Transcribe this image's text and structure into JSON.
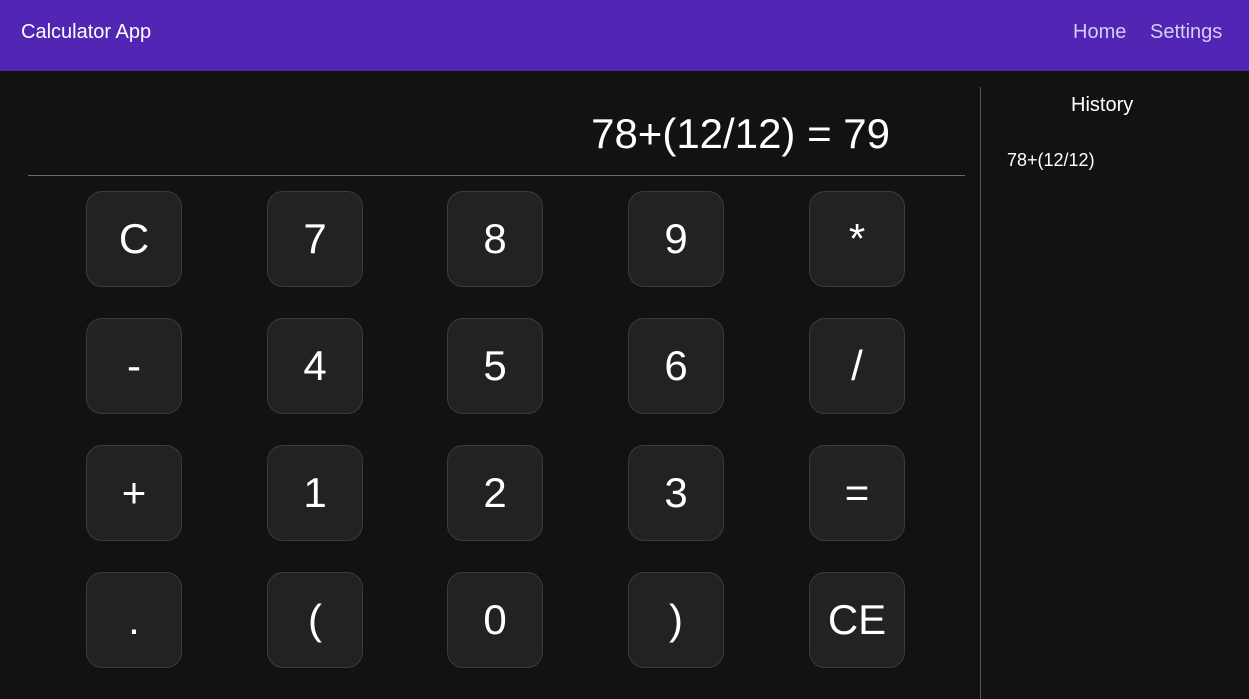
{
  "header": {
    "title": "Calculator App",
    "nav": [
      "Home",
      "Settings"
    ]
  },
  "display": {
    "expression": "78+(12/12) = 79"
  },
  "keypad": {
    "rows": [
      [
        "C",
        "7",
        "8",
        "9",
        "*"
      ],
      [
        "-",
        "4",
        "5",
        "6",
        "/"
      ],
      [
        "+",
        "1",
        "2",
        "3",
        "="
      ],
      [
        ".",
        "(",
        "0",
        ")",
        "CE"
      ]
    ]
  },
  "history": {
    "title": "History",
    "items": [
      "78+(12/12)"
    ]
  },
  "colors": {
    "header_bg": "#5225b4",
    "background": "#121212",
    "key_bg": "#222222",
    "text": "#ffffff",
    "nav_text": "#d8ccf2"
  }
}
